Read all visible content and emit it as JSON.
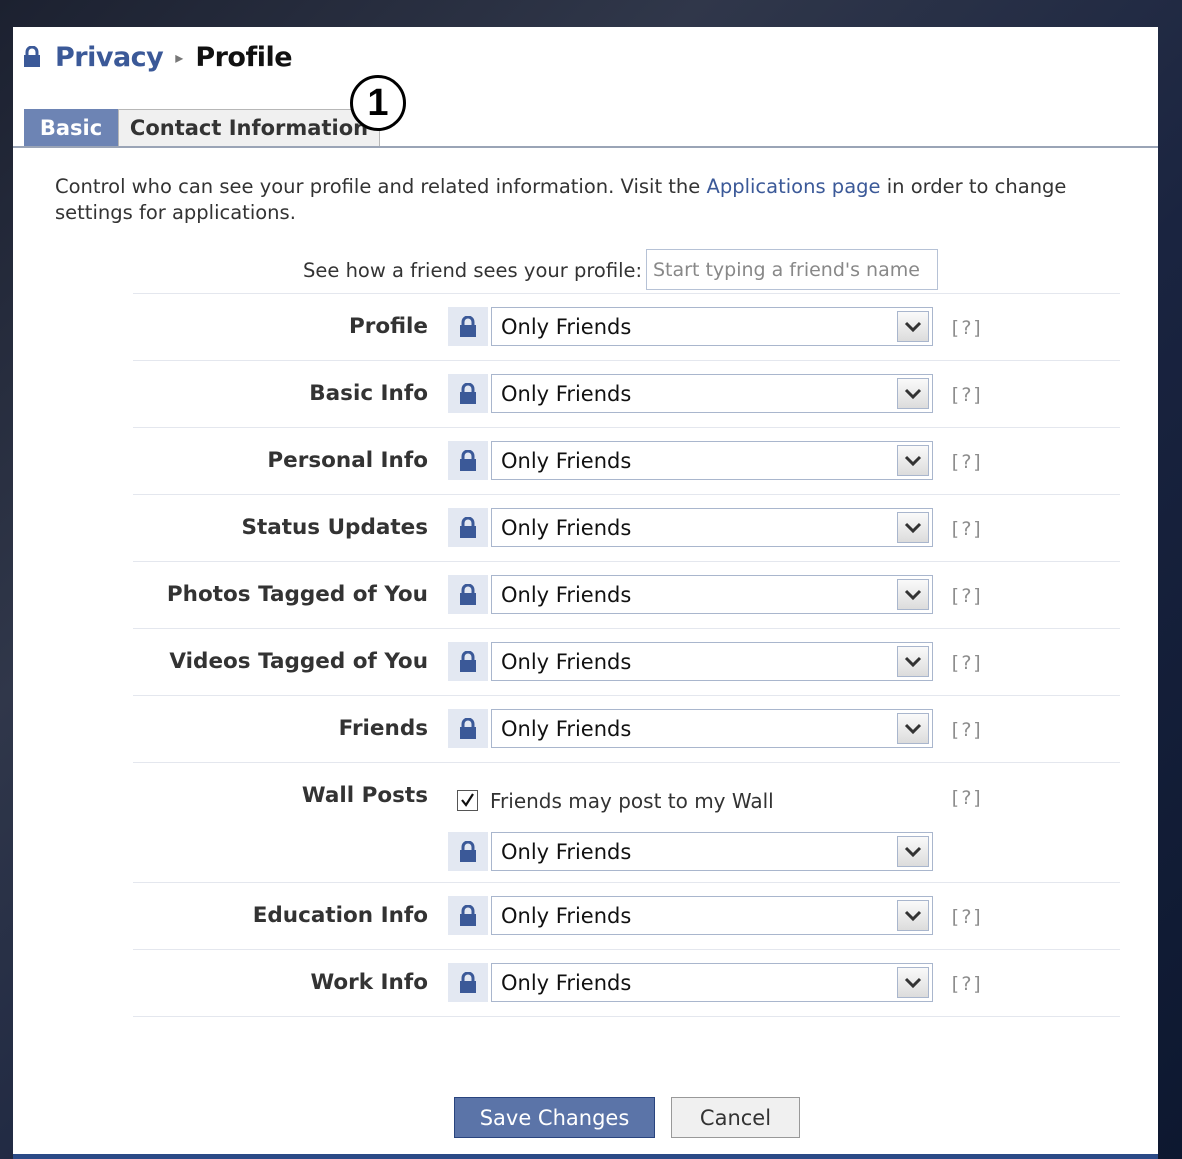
{
  "breadcrumb": {
    "parent": "Privacy",
    "separator": "▸",
    "current": "Profile"
  },
  "tabs": [
    {
      "label": "Basic",
      "active": true
    },
    {
      "label": "Contact Information",
      "active": false
    }
  ],
  "callout": "1",
  "intro": {
    "before": "Control who can see your profile and related information. Visit the ",
    "link": "Applications page",
    "after": " in order to change settings for applications."
  },
  "preview": {
    "label": "See how a friend sees your profile:",
    "placeholder": "Start typing a friend's name"
  },
  "settings": [
    {
      "label": "Profile",
      "value": "Only Friends",
      "help": "[?]"
    },
    {
      "label": "Basic Info",
      "value": "Only Friends",
      "help": "[?]"
    },
    {
      "label": "Personal Info",
      "value": "Only Friends",
      "help": "[?]"
    },
    {
      "label": "Status Updates",
      "value": "Only Friends",
      "help": "[?]"
    },
    {
      "label": "Photos Tagged of You",
      "value": "Only Friends",
      "help": "[?]"
    },
    {
      "label": "Videos Tagged of You",
      "value": "Only Friends",
      "help": "[?]"
    },
    {
      "label": "Friends",
      "value": "Only Friends",
      "help": "[?]"
    },
    {
      "label": "Wall Posts",
      "value": "Only Friends",
      "help": "[?]",
      "checkbox_label": "Friends may post to my Wall",
      "checked": true
    },
    {
      "label": "Education Info",
      "value": "Only Friends",
      "help": "[?]"
    },
    {
      "label": "Work Info",
      "value": "Only Friends",
      "help": "[?]"
    }
  ],
  "buttons": {
    "save": "Save Changes",
    "cancel": "Cancel"
  },
  "colors": {
    "brand": "#3b5998",
    "active_tab": "#6d84b4",
    "save_button": "#5b74a8"
  },
  "icons": {
    "lock": "lock-icon",
    "dropdown": "chevron-down-icon",
    "check": "checkmark-icon"
  }
}
